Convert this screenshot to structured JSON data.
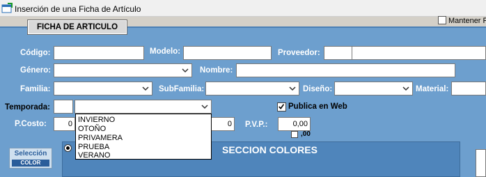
{
  "window": {
    "title": "Inserción de una Ficha de Artículo"
  },
  "header": {
    "tab_label": "FICHA DE ARTICULO",
    "mantener_label": "Mantener F"
  },
  "form": {
    "codigo_label": "Código:",
    "modelo_label": "Modelo:",
    "proveedor_label": "Proveedor:",
    "genero_label": "Género:",
    "nombre_label": "Nombre:",
    "familia_label": "Familia:",
    "subfamilia_label": "SubFamilia:",
    "diseno_label": "Diseño:",
    "material_label": "Material:",
    "temporada_label": "Temporada:",
    "publica_web_label": "Publica en Web",
    "publica_web_checked": true,
    "pcosto_label": "P.Costo:",
    "pcosto_value": "0",
    "mid_value": "0",
    "pvp_label": "P.V.P.:",
    "pvp_value": "0,00",
    "decimals_label": ",00"
  },
  "temporada_dropdown": {
    "options": [
      "INVIERNO",
      "OTOÑO",
      "PRIVAMERA",
      "PRUEBA",
      "VERANO"
    ]
  },
  "colors_section": {
    "title": "SECCION COLORES",
    "button_line1": "Selección",
    "button_line2": "COLOR"
  }
}
